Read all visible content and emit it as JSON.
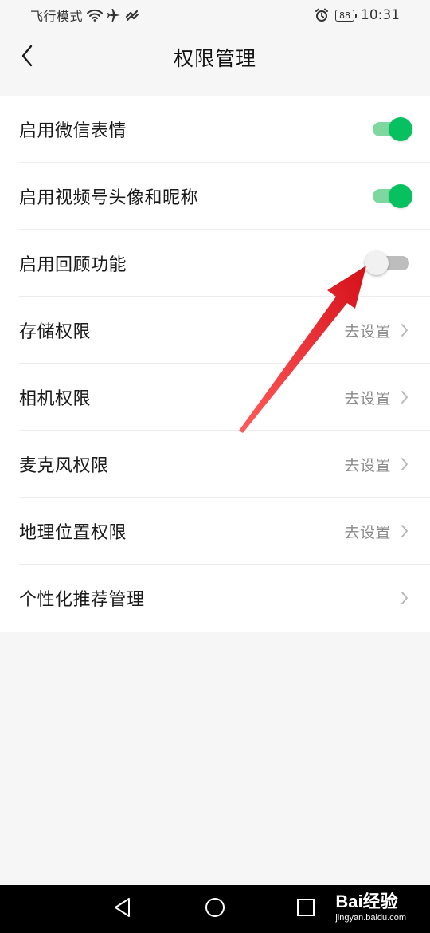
{
  "status_bar": {
    "mode_text": "飞行模式",
    "battery": "88",
    "time": "10:31"
  },
  "header": {
    "title": "权限管理"
  },
  "settings": [
    {
      "label": "启用微信表情",
      "control": "toggle",
      "on": true
    },
    {
      "label": "启用视频号头像和昵称",
      "control": "toggle",
      "on": true
    },
    {
      "label": "启用回顾功能",
      "control": "toggle",
      "on": false
    },
    {
      "label": "存储权限",
      "control": "link",
      "value": "去设置"
    },
    {
      "label": "相机权限",
      "control": "link",
      "value": "去设置"
    },
    {
      "label": "麦克风权限",
      "control": "link",
      "value": "去设置"
    },
    {
      "label": "地理位置权限",
      "control": "link",
      "value": "去设置"
    },
    {
      "label": "个性化推荐管理",
      "control": "link",
      "value": ""
    }
  ],
  "colors": {
    "toggle_on": "#07c160",
    "toggle_on_track": "#7fd7a0",
    "toggle_off_track": "#bdbdbd",
    "annotation_arrow": "#e8141c"
  },
  "icons": {
    "back": "chevron-left-icon",
    "chevron": "chevron-right-icon",
    "nav_back": "triangle-back-icon",
    "nav_home": "circle-home-icon",
    "nav_recent": "square-recent-icon"
  },
  "watermark": {
    "logo": "Bai经验",
    "url": "jingyan.baidu.com"
  }
}
